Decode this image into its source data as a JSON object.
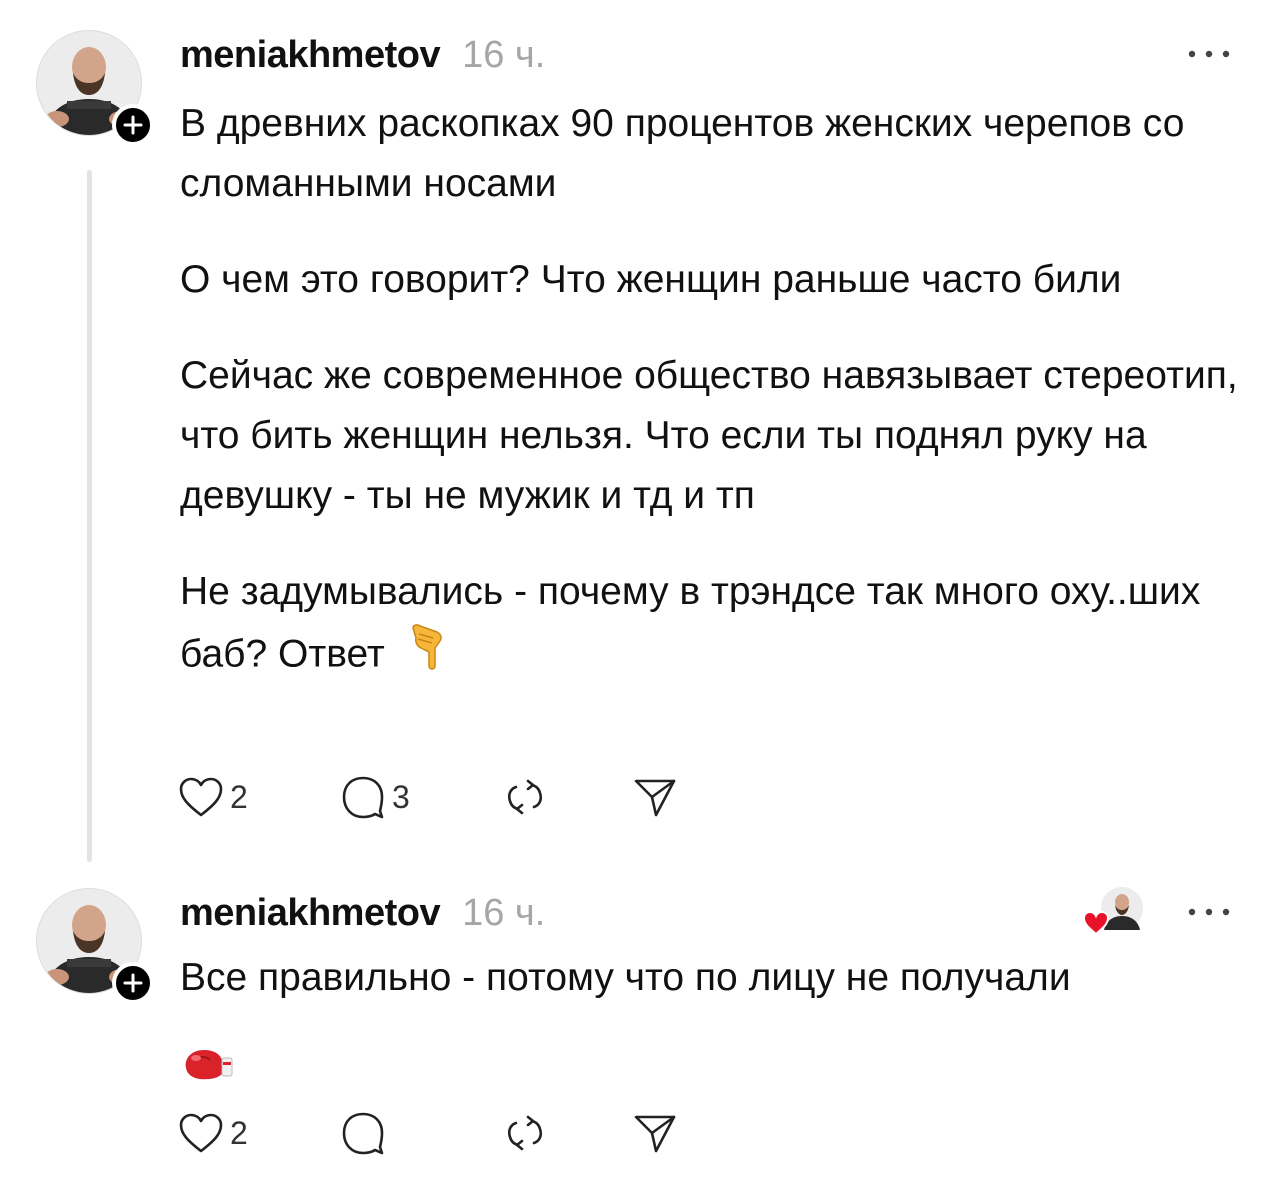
{
  "posts": [
    {
      "username": "meniakhmetov",
      "time": "16 ч.",
      "paragraphs": [
        "В древних раскопках 90 процентов женских черепов со сломанными носами",
        "О чем это говорит? Что женщин раньше часто били",
        "Сейчас же современное общество навязывает стереотип, что бить женщин нельзя. Что если ты поднял руку на девушку - ты не мужик и тд и тп",
        "Не задумывались - почему в трэндсе так много оху..ших баб? Ответ"
      ],
      "trailing_emoji": "pointing-down-hand-emoji",
      "likes": "2",
      "replies": "3"
    },
    {
      "username": "meniakhmetov",
      "time": "16 ч.",
      "paragraphs": [
        "Все правильно - потому что по лицу не получали"
      ],
      "trailing_emoji": "boxing-glove-emoji",
      "likes": "2",
      "replies": ""
    }
  ],
  "colors": {
    "text": "#111111",
    "muted": "#a6a6a6",
    "thread_line": "#e3e3e3",
    "heart_red": "#e8132b"
  }
}
